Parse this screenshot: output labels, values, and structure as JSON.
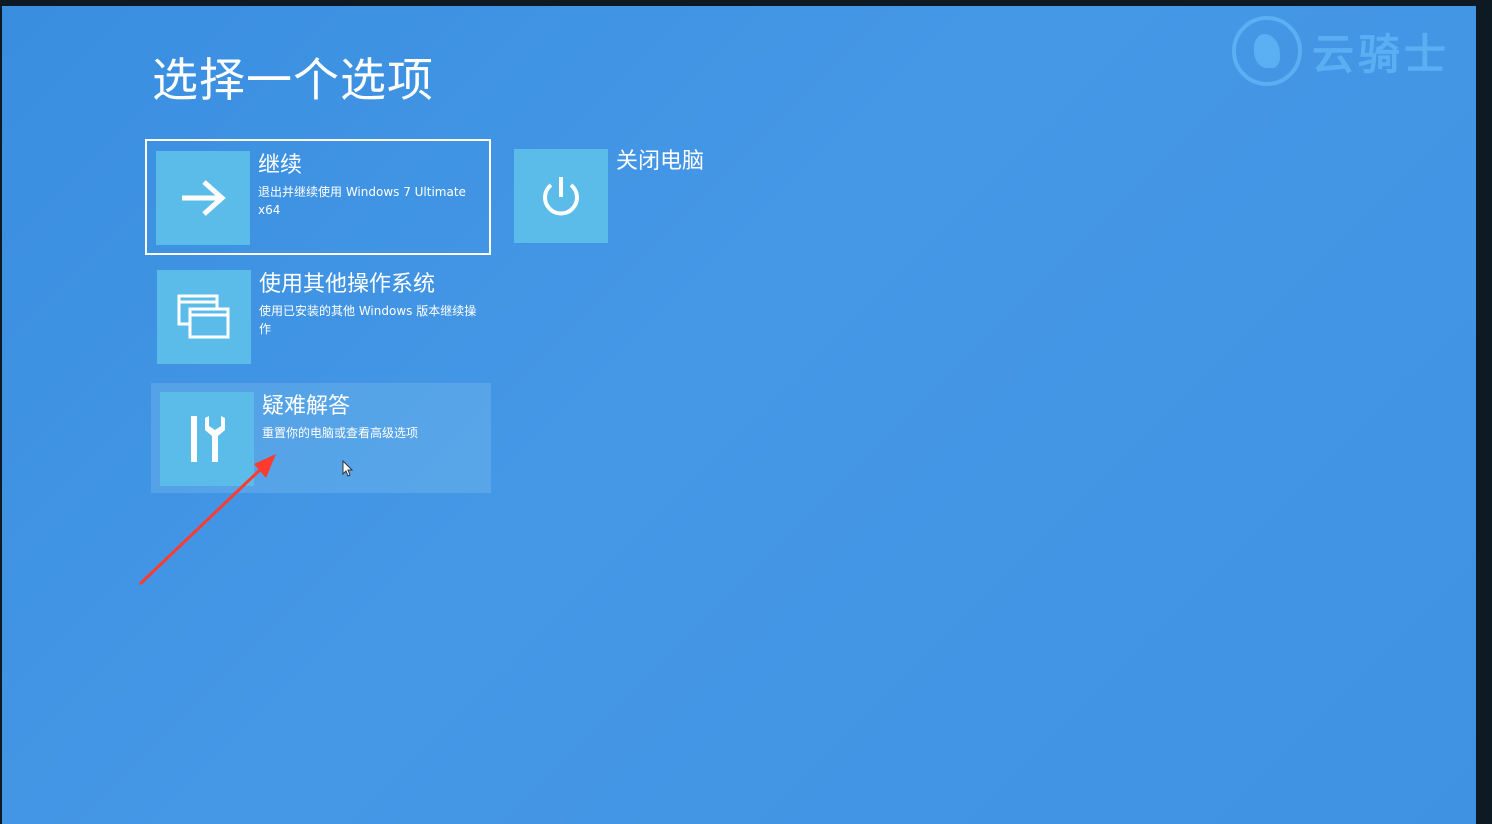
{
  "page_title": "选择一个选项",
  "watermark_text": "云骑士",
  "options": [
    {
      "title": "继续",
      "desc": "退出并继续使用 Windows 7 Ultimate x64",
      "icon": "arrow-right-icon",
      "state": "selected"
    },
    {
      "title": "关闭电脑",
      "desc": "",
      "icon": "power-icon",
      "state": "normal"
    },
    {
      "title": "使用其他操作系统",
      "desc": "使用已安装的其他 Windows 版本继续操作",
      "icon": "windows-stack-icon",
      "state": "normal"
    },
    {
      "title": "疑难解答",
      "desc": "重置你的电脑或查看高级选项",
      "icon": "tools-icon",
      "state": "hover"
    }
  ],
  "colors": {
    "background": "#4598e6",
    "tile": "#5bbcea",
    "text": "#ffffff",
    "annotation_arrow": "#ff3b2f"
  }
}
